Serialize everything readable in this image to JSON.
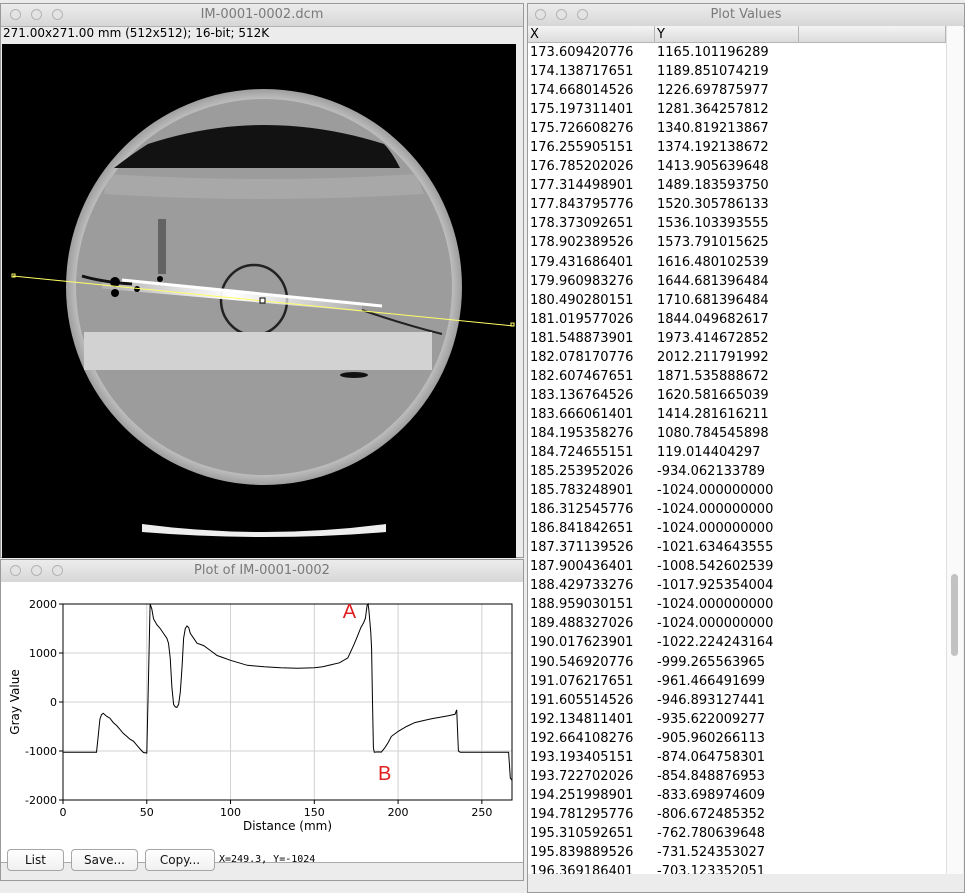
{
  "image_window": {
    "title": "IM-0001-0002.dcm",
    "info": "271.00x271.00 mm (512x512); 16-bit; 512K"
  },
  "plot_window": {
    "title": "Plot of IM-0001-0002",
    "buttons": {
      "list": "List",
      "save": "Save...",
      "copy": "Copy..."
    },
    "coords": "X=249.3, Y=-1024",
    "annotations": [
      "A",
      "B"
    ]
  },
  "values_window": {
    "title": "Plot Values",
    "columns": [
      "X",
      "Y"
    ],
    "rows": [
      [
        "173.609420776",
        "1165.101196289"
      ],
      [
        "174.138717651",
        "1189.851074219"
      ],
      [
        "174.668014526",
        "1226.697875977"
      ],
      [
        "175.197311401",
        "1281.364257812"
      ],
      [
        "175.726608276",
        "1340.819213867"
      ],
      [
        "176.255905151",
        "1374.192138672"
      ],
      [
        "176.785202026",
        "1413.905639648"
      ],
      [
        "177.314498901",
        "1489.183593750"
      ],
      [
        "177.843795776",
        "1520.305786133"
      ],
      [
        "178.373092651",
        "1536.103393555"
      ],
      [
        "178.902389526",
        "1573.791015625"
      ],
      [
        "179.431686401",
        "1616.480102539"
      ],
      [
        "179.960983276",
        "1644.681396484"
      ],
      [
        "180.490280151",
        "1710.681396484"
      ],
      [
        "181.019577026",
        "1844.049682617"
      ],
      [
        "181.548873901",
        "1973.414672852"
      ],
      [
        "182.078170776",
        "2012.211791992"
      ],
      [
        "182.607467651",
        "1871.535888672"
      ],
      [
        "183.136764526",
        "1620.581665039"
      ],
      [
        "183.666061401",
        "1414.281616211"
      ],
      [
        "184.195358276",
        "1080.784545898"
      ],
      [
        "184.724655151",
        "119.014404297"
      ],
      [
        "185.253952026",
        "-934.062133789"
      ],
      [
        "185.783248901",
        "-1024.000000000"
      ],
      [
        "186.312545776",
        "-1024.000000000"
      ],
      [
        "186.841842651",
        "-1024.000000000"
      ],
      [
        "187.371139526",
        "-1021.634643555"
      ],
      [
        "187.900436401",
        "-1008.542602539"
      ],
      [
        "188.429733276",
        "-1017.925354004"
      ],
      [
        "188.959030151",
        "-1024.000000000"
      ],
      [
        "189.488327026",
        "-1024.000000000"
      ],
      [
        "190.017623901",
        "-1022.224243164"
      ],
      [
        "190.546920776",
        "-999.265563965"
      ],
      [
        "191.076217651",
        "-961.466491699"
      ],
      [
        "191.605514526",
        "-946.893127441"
      ],
      [
        "192.134811401",
        "-935.622009277"
      ],
      [
        "192.664108276",
        "-905.960266113"
      ],
      [
        "193.193405151",
        "-874.064758301"
      ],
      [
        "193.722702026",
        "-854.848876953"
      ],
      [
        "194.251998901",
        "-833.698974609"
      ],
      [
        "194.781295776",
        "-806.672485352"
      ],
      [
        "195.310592651",
        "-762.780639648"
      ],
      [
        "195.839889526",
        "-731.524353027"
      ],
      [
        "196.369186401",
        "-703.123352051"
      ]
    ]
  },
  "chart_data": {
    "type": "line",
    "xlabel": "Distance (mm)",
    "ylabel": "Gray Value",
    "xlim": [
      0,
      268
    ],
    "ylim": [
      -2000,
      2000
    ],
    "x_ticks": [
      "0",
      "50",
      "100",
      "150",
      "200",
      "250"
    ],
    "y_ticks": [
      "2000",
      "1000",
      "0",
      "-1000",
      "-2000"
    ],
    "grid": true,
    "series": [
      {
        "x": [
          0,
          20,
          21,
          22,
          23,
          24,
          26,
          28,
          30,
          32,
          34,
          36,
          38,
          40,
          42,
          44,
          46,
          48,
          50,
          51,
          52,
          53,
          54,
          56,
          58,
          60,
          62,
          63,
          64,
          65,
          66,
          67,
          68,
          69,
          70,
          71,
          72,
          73,
          74,
          75,
          76,
          78,
          80,
          84,
          88,
          92,
          96,
          100,
          110,
          120,
          130,
          140,
          150,
          155,
          160,
          165,
          170,
          173.6,
          175.7,
          177.8,
          179.4,
          180.5,
          181.5,
          182.1,
          182.6,
          183.7,
          184.2,
          184.7,
          185.3,
          185.8,
          188,
          190,
          192,
          194,
          196,
          200,
          205,
          210,
          215,
          220,
          225,
          230,
          234,
          235,
          236,
          237,
          240,
          250,
          260,
          266,
          267,
          268
        ],
        "y": [
          -1024,
          -1024,
          -700,
          -350,
          -260,
          -230,
          -290,
          -330,
          -420,
          -480,
          -560,
          -640,
          -700,
          -760,
          -800,
          -880,
          -960,
          -1030,
          -1040,
          400,
          2000,
          1900,
          1700,
          1580,
          1500,
          1400,
          1300,
          1200,
          900,
          300,
          -50,
          -100,
          -110,
          -50,
          200,
          700,
          1300,
          1500,
          1550,
          1520,
          1400,
          1300,
          1200,
          1150,
          1050,
          950,
          900,
          850,
          750,
          720,
          700,
          690,
          700,
          720,
          760,
          800,
          900,
          1165,
          1340,
          1520,
          1616,
          1710,
          1973,
          2012,
          1871,
          1414,
          1080,
          119,
          -934,
          -1024,
          -1018,
          -1022,
          -936,
          -834,
          -703,
          -600,
          -500,
          -420,
          -380,
          -340,
          -310,
          -280,
          -250,
          -160,
          -1000,
          -1024,
          -1024,
          -1024,
          -1024,
          -1024,
          -1550,
          -1600
        ]
      }
    ]
  }
}
